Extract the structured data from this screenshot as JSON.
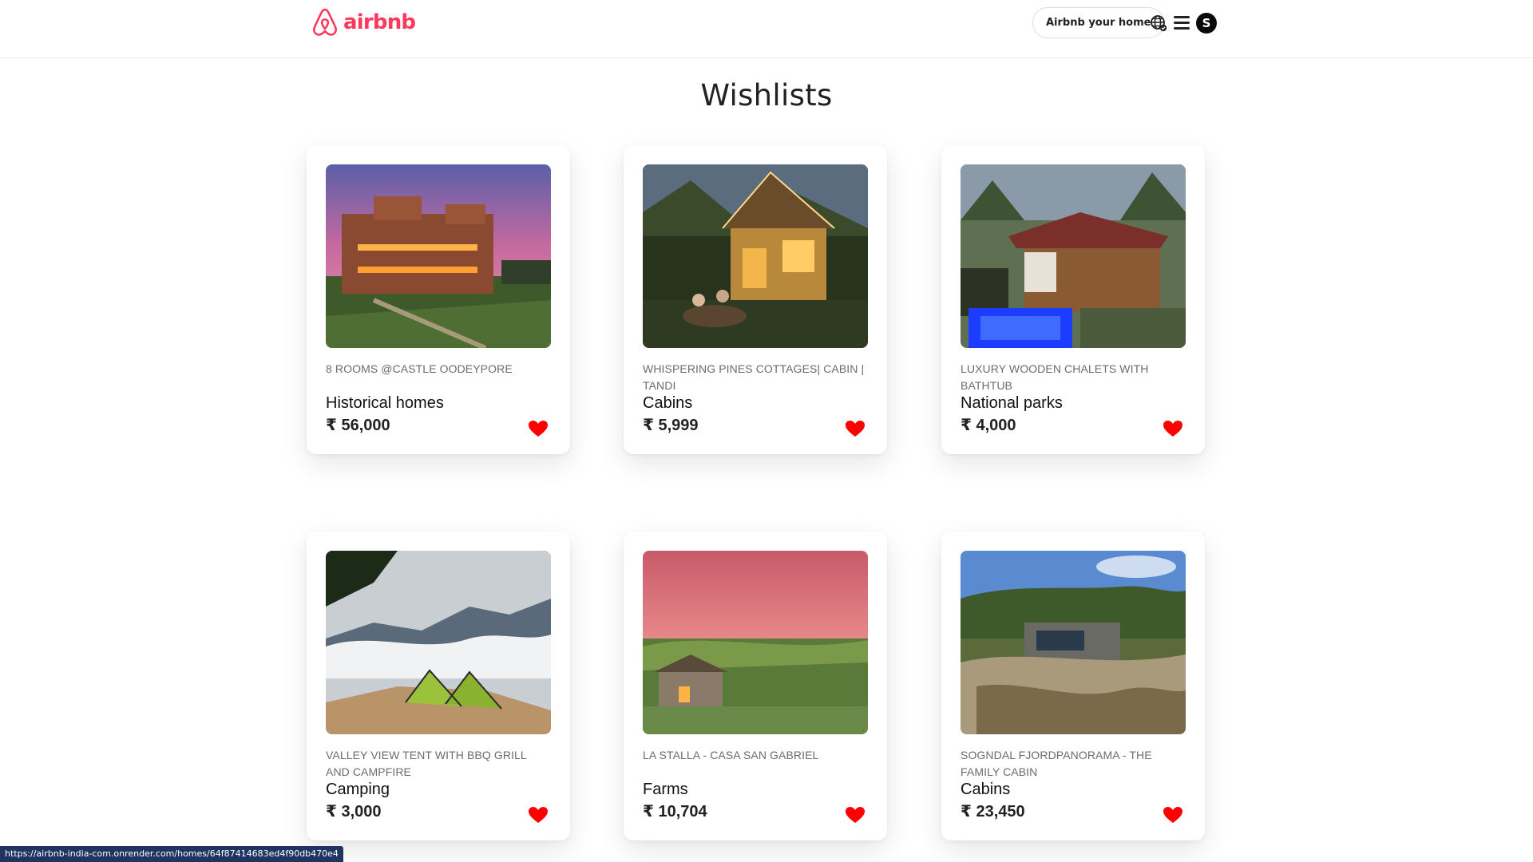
{
  "header": {
    "brand": "airbnb",
    "host_label": "Airbnb your home",
    "avatar_initial": "S",
    "icons": {
      "logo": "airbnb-logo-icon",
      "globe": "globe-icon",
      "menu": "hamburger-menu-icon"
    }
  },
  "page": {
    "title": "Wishlists"
  },
  "wishlist": [
    {
      "name": "8 ROOMS @CASTLE OODEYPORE",
      "category": "Historical homes",
      "price": "₹ 56,000",
      "favorite": true
    },
    {
      "name": "WHISPERING PINES COTTAGES| CABIN | TANDI",
      "category": "Cabins",
      "price": "₹ 5,999",
      "favorite": true
    },
    {
      "name": "LUXURY WOODEN CHALETS WITH BATHTUB",
      "category": "National parks",
      "price": "₹ 4,000",
      "favorite": true
    },
    {
      "name": "VALLEY VIEW TENT WITH BBQ GRILL AND CAMPFIRE",
      "category": "Camping",
      "price": "₹ 3,000",
      "favorite": true
    },
    {
      "name": "LA STALLA - CASA SAN GABRIEL",
      "category": "Farms",
      "price": "₹ 10,704",
      "favorite": true
    },
    {
      "name": "SOGNDAL FJORDPANORAMA - THE FAMILY CABIN",
      "category": "Cabins",
      "price": "₹ 23,450",
      "favorite": true
    }
  ],
  "status_bar": {
    "url": "https://airbnb-india-com.onrender.com/homes/64f87414683ed4f90db470e4"
  },
  "colors": {
    "brand": "#ff385c",
    "heart": "#ff0000",
    "text": "#222222",
    "muted": "#6b6b72"
  }
}
